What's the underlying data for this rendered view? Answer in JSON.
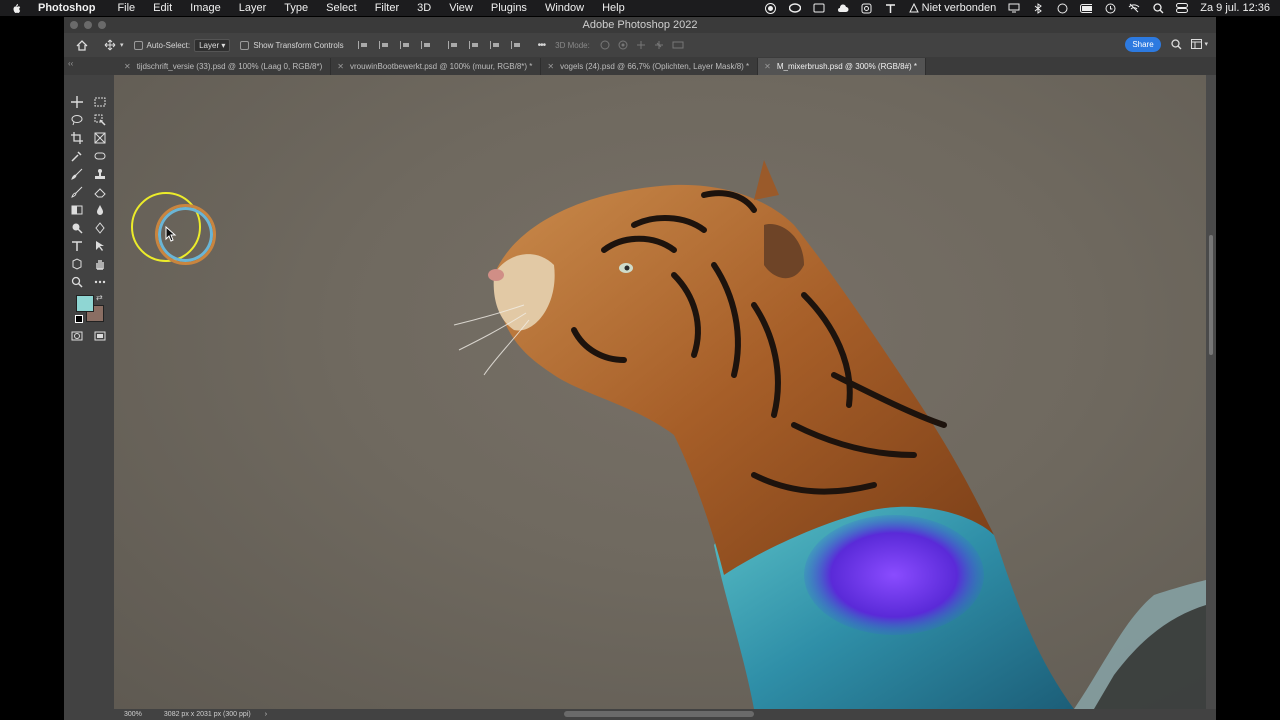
{
  "menubar": {
    "app_name": "Photoshop",
    "menus": [
      "File",
      "Edit",
      "Image",
      "Layer",
      "Type",
      "Select",
      "Filter",
      "3D",
      "View",
      "Plugins",
      "Window",
      "Help"
    ],
    "network_status": "Niet verbonden",
    "datetime": "Za 9 jul.  12:36"
  },
  "window": {
    "title": "Adobe Photoshop 2022"
  },
  "options_bar": {
    "auto_select_label": "Auto-Select:",
    "auto_select_value": "Layer",
    "transform_label": "Show Transform Controls",
    "mode_3d_label": "3D Mode:",
    "share_label": "Share"
  },
  "tabs": [
    {
      "label": "tijdschrift_versie (33).psd @ 100% (Laag 0, RGB/8*)",
      "active": false
    },
    {
      "label": "vrouwinBootbewerkt.psd @ 100% (muur, RGB/8*) *",
      "active": false
    },
    {
      "label": "vogels (24).psd @ 66,7% (Oplichten, Layer Mask/8) *",
      "active": false
    },
    {
      "label": "M_mixerbrush.psd @ 300% (RGB/8#) *",
      "active": true
    }
  ],
  "tools": {
    "foreground_color": "#8fd6d3",
    "background_color": "#8a6e63"
  },
  "status_bar": {
    "zoom": "300%",
    "dimensions": "3082 px x 2031 px (300 ppi)",
    "arrow": "›"
  },
  "colors": {
    "accent": "#2d7ae0",
    "panel": "#424242",
    "canvas_bg": "#535353"
  }
}
